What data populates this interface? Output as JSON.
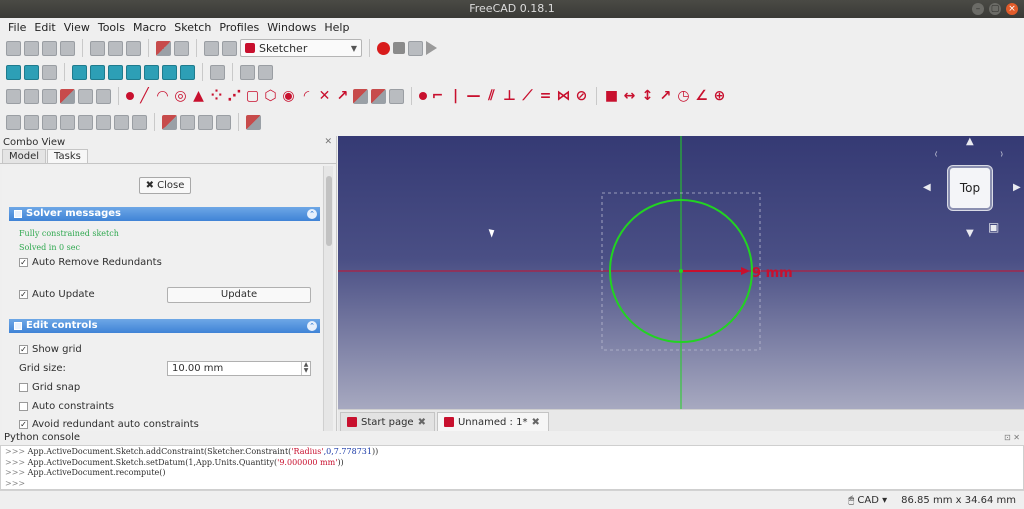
{
  "window": {
    "title": "FreeCAD 0.18.1"
  },
  "menu": [
    "File",
    "Edit",
    "View",
    "Tools",
    "Macro",
    "Sketch",
    "Profiles",
    "Windows",
    "Help"
  ],
  "workbench": {
    "selected": "Sketcher"
  },
  "combo_view": {
    "title": "Combo View",
    "tabs": [
      "Model",
      "Tasks"
    ],
    "close_label": "Close",
    "solver": {
      "header": "Solver messages",
      "status": "Fully constrained sketch",
      "time": "Solved in 0 sec",
      "auto_remove_label": "Auto Remove Redundants",
      "auto_update_label": "Auto Update",
      "update_label": "Update"
    },
    "edit_controls": {
      "header": "Edit controls",
      "show_grid_label": "Show grid",
      "grid_size_label": "Grid size:",
      "grid_size_value": "10.00 mm",
      "grid_snap_label": "Grid snap",
      "auto_constraints_label": "Auto constraints",
      "avoid_redundant_label": "Avoid redundant auto constraints"
    }
  },
  "viewport": {
    "dimension_label": "9 mm",
    "navcube_face": "Top",
    "circle_color": "#22d322",
    "constraint_color": "#c8102e"
  },
  "doc_tabs": [
    {
      "label": "Start page"
    },
    {
      "label": "Unnamed : 1*"
    }
  ],
  "console": {
    "title": "Python console",
    "prompt": ">>>",
    "line1_pre": "App.ActiveDocument.Sketch.addConstraint(Sketcher.Constraint(",
    "line1_str": "'Radius'",
    "line1_num": ",0,7.778731",
    "line1_post": "))",
    "line2_pre": "App.ActiveDocument.Sketch.setDatum(1,App.Units.Quantity(",
    "line2_str": "'9.000000 mm'",
    "line2_post": "))",
    "line3": "App.ActiveDocument.recompute()"
  },
  "status": {
    "nav_style": "CAD",
    "dimensions": "86.85 mm x 34.64 mm"
  }
}
